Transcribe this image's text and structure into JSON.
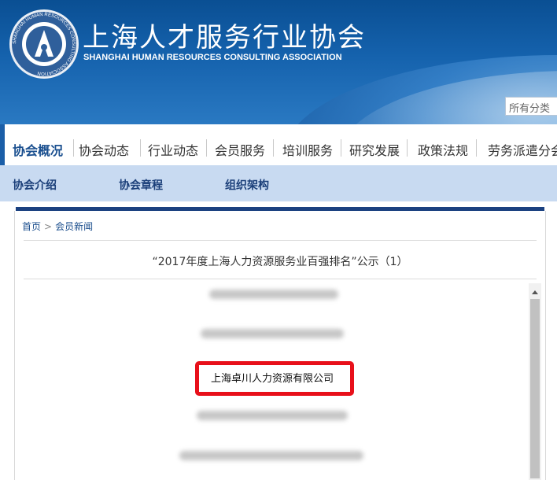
{
  "header": {
    "title": "上海人才服务行业协会",
    "subtitle": "SHANGHAI HUMAN RESOURCES CONSULTING ASSOCIATION",
    "logo_text": "SHANGHAI HUMAN RESOURCES CONSULTING ASSOCIATION",
    "category_label": "所有分类"
  },
  "main_nav": {
    "items": [
      "协会概况",
      "协会动态",
      "行业动态",
      "会员服务",
      "培训服务",
      "研究发展",
      "政策法规",
      "劳务派遣分会"
    ]
  },
  "sub_nav": {
    "items": [
      "协会介绍",
      "协会章程",
      "组织架构"
    ]
  },
  "breadcrumb": {
    "home": "首页",
    "arrow": ">",
    "current": "会员新闻"
  },
  "document": {
    "title": "“2017年度上海人力资源服务业百强排名”公示（1）",
    "highlighted_company": "上海卓川人力资源有限公司"
  },
  "colors": {
    "header_blue": "#1562ad",
    "nav_accent": "#1a5ea8",
    "subnav_bg": "#c8daf1",
    "highlight_red": "#e8101a"
  }
}
